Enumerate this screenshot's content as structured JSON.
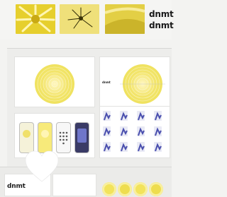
{
  "brand": {
    "top_line_1": "dnmt",
    "top_line_2": "dnmt",
    "bottom": "dnmt",
    "label_small": "dnmt"
  },
  "colors": {
    "accent": "#f2e35c",
    "accent_light": "#f9f1a6",
    "ink": "#1a1a1a",
    "poster_blue": "#4a4fae",
    "heart": "#ffffff"
  },
  "icons": {
    "like": "heart-icon"
  },
  "phones": [
    {
      "variant": "yellow-ring"
    },
    {
      "variant": "yellow-ring"
    },
    {
      "variant": "keypad"
    },
    {
      "variant": "dark-cover"
    }
  ]
}
